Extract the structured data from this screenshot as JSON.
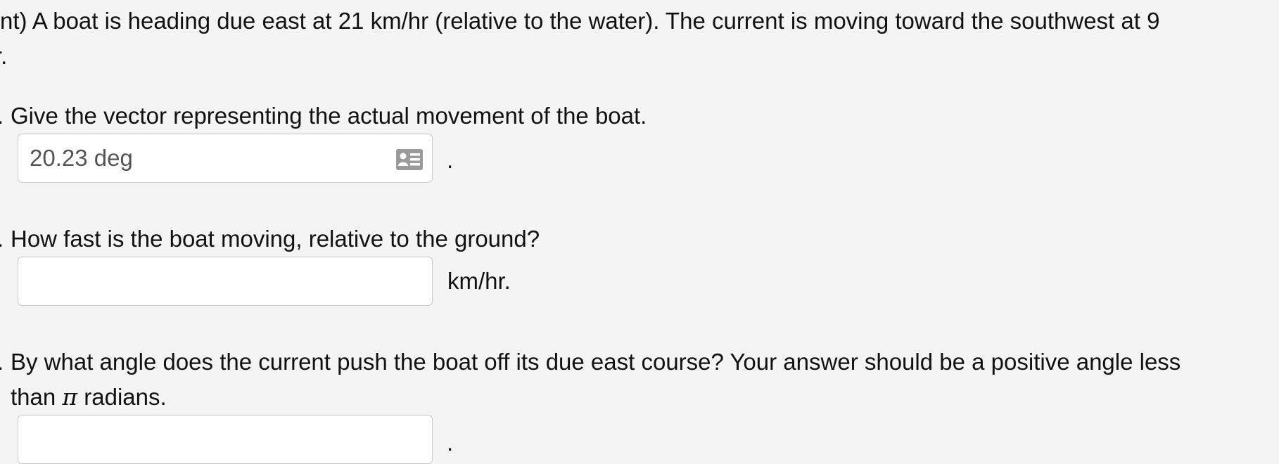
{
  "problem": {
    "intro_line1": "nt) A boat is heading due east at 21 km/hr (relative to the water). The current is moving toward the southwest at 9",
    "intro_line2_fragment": "r."
  },
  "parts": [
    {
      "marker": ".",
      "question": "Give the vector representing the actual movement of the boat.",
      "input_value": "20.23 deg",
      "after": ".",
      "icon": "preview-answer-icon"
    },
    {
      "marker": ".",
      "question": "How fast is the boat moving, relative to the ground?",
      "input_value": "",
      "after": "km/hr."
    },
    {
      "marker": ".",
      "question_line1": "By what angle does the current push the boat off its due east course? Your answer should be a positive angle less",
      "question_line2_before_pi": "than ",
      "pi_symbol": "π",
      "question_line2_after_pi": " radians.",
      "input_value": "",
      "after": "."
    }
  ]
}
